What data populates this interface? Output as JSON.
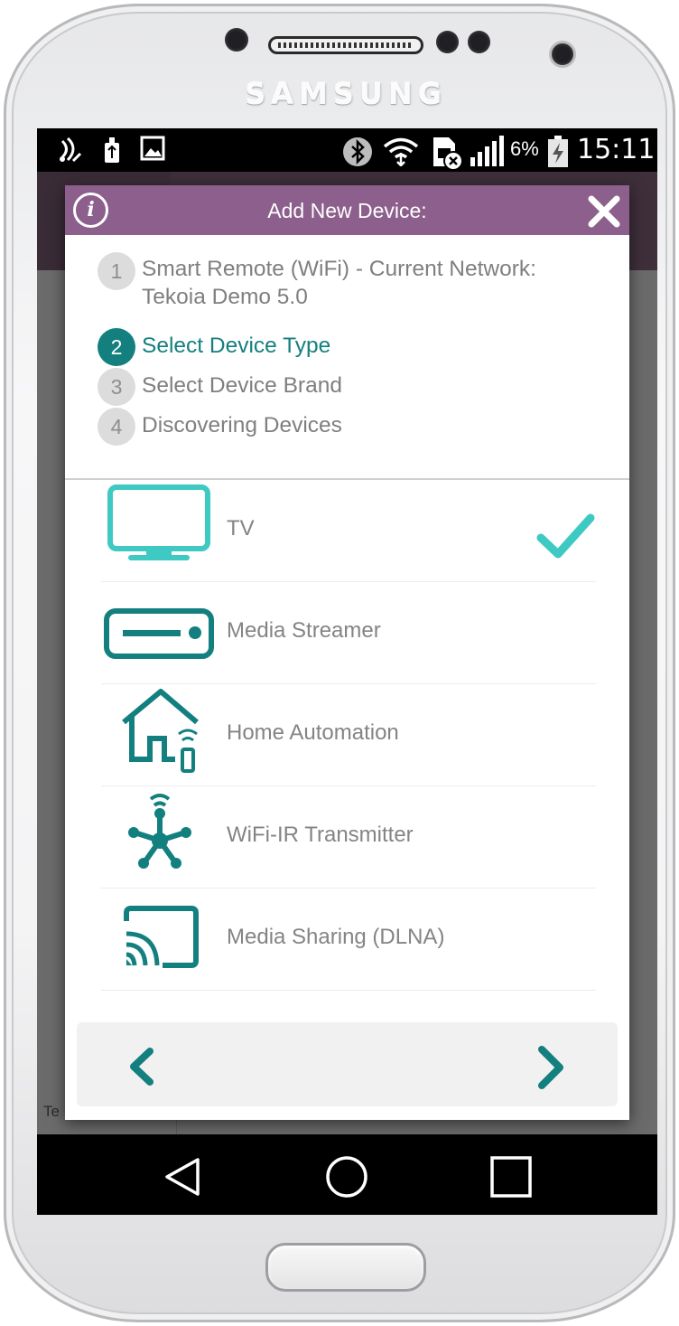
{
  "device_brand": "SAMSUNG",
  "status_bar": {
    "battery_percent": "6%",
    "time": "15:11",
    "icons": [
      "nfc-icon",
      "usb-debug-icon",
      "image-icon",
      "bluetooth-icon",
      "wifi-icon",
      "sim-error-icon",
      "signal-icon",
      "battery-charging-icon"
    ]
  },
  "dialog": {
    "title": "Add New Device:",
    "steps": [
      {
        "number": "1",
        "label": "Smart Remote (WiFi) - Current Network: Tekoia Demo 5.0",
        "state": "done"
      },
      {
        "number": "2",
        "label": "Select Device Type",
        "state": "active"
      },
      {
        "number": "3",
        "label": "Select Device Brand",
        "state": "pending"
      },
      {
        "number": "4",
        "label": "Discovering Devices",
        "state": "pending"
      }
    ],
    "device_types": [
      {
        "label": "TV",
        "icon": "tv-icon",
        "selected": true
      },
      {
        "label": "Media Streamer",
        "icon": "media-streamer-icon",
        "selected": false
      },
      {
        "label": "Home Automation",
        "icon": "home-automation-icon",
        "selected": false
      },
      {
        "label": "WiFi-IR Transmitter",
        "icon": "wifi-ir-transmitter-icon",
        "selected": false
      },
      {
        "label": "Media Sharing (DLNA)",
        "icon": "cast-icon",
        "selected": false
      }
    ]
  },
  "background": {
    "peek_text": "Te"
  },
  "colors": {
    "header": "#8c5f8c",
    "teal": "#13807f",
    "tv_accent": "#3ec9c3",
    "text_gray": "#848484"
  }
}
